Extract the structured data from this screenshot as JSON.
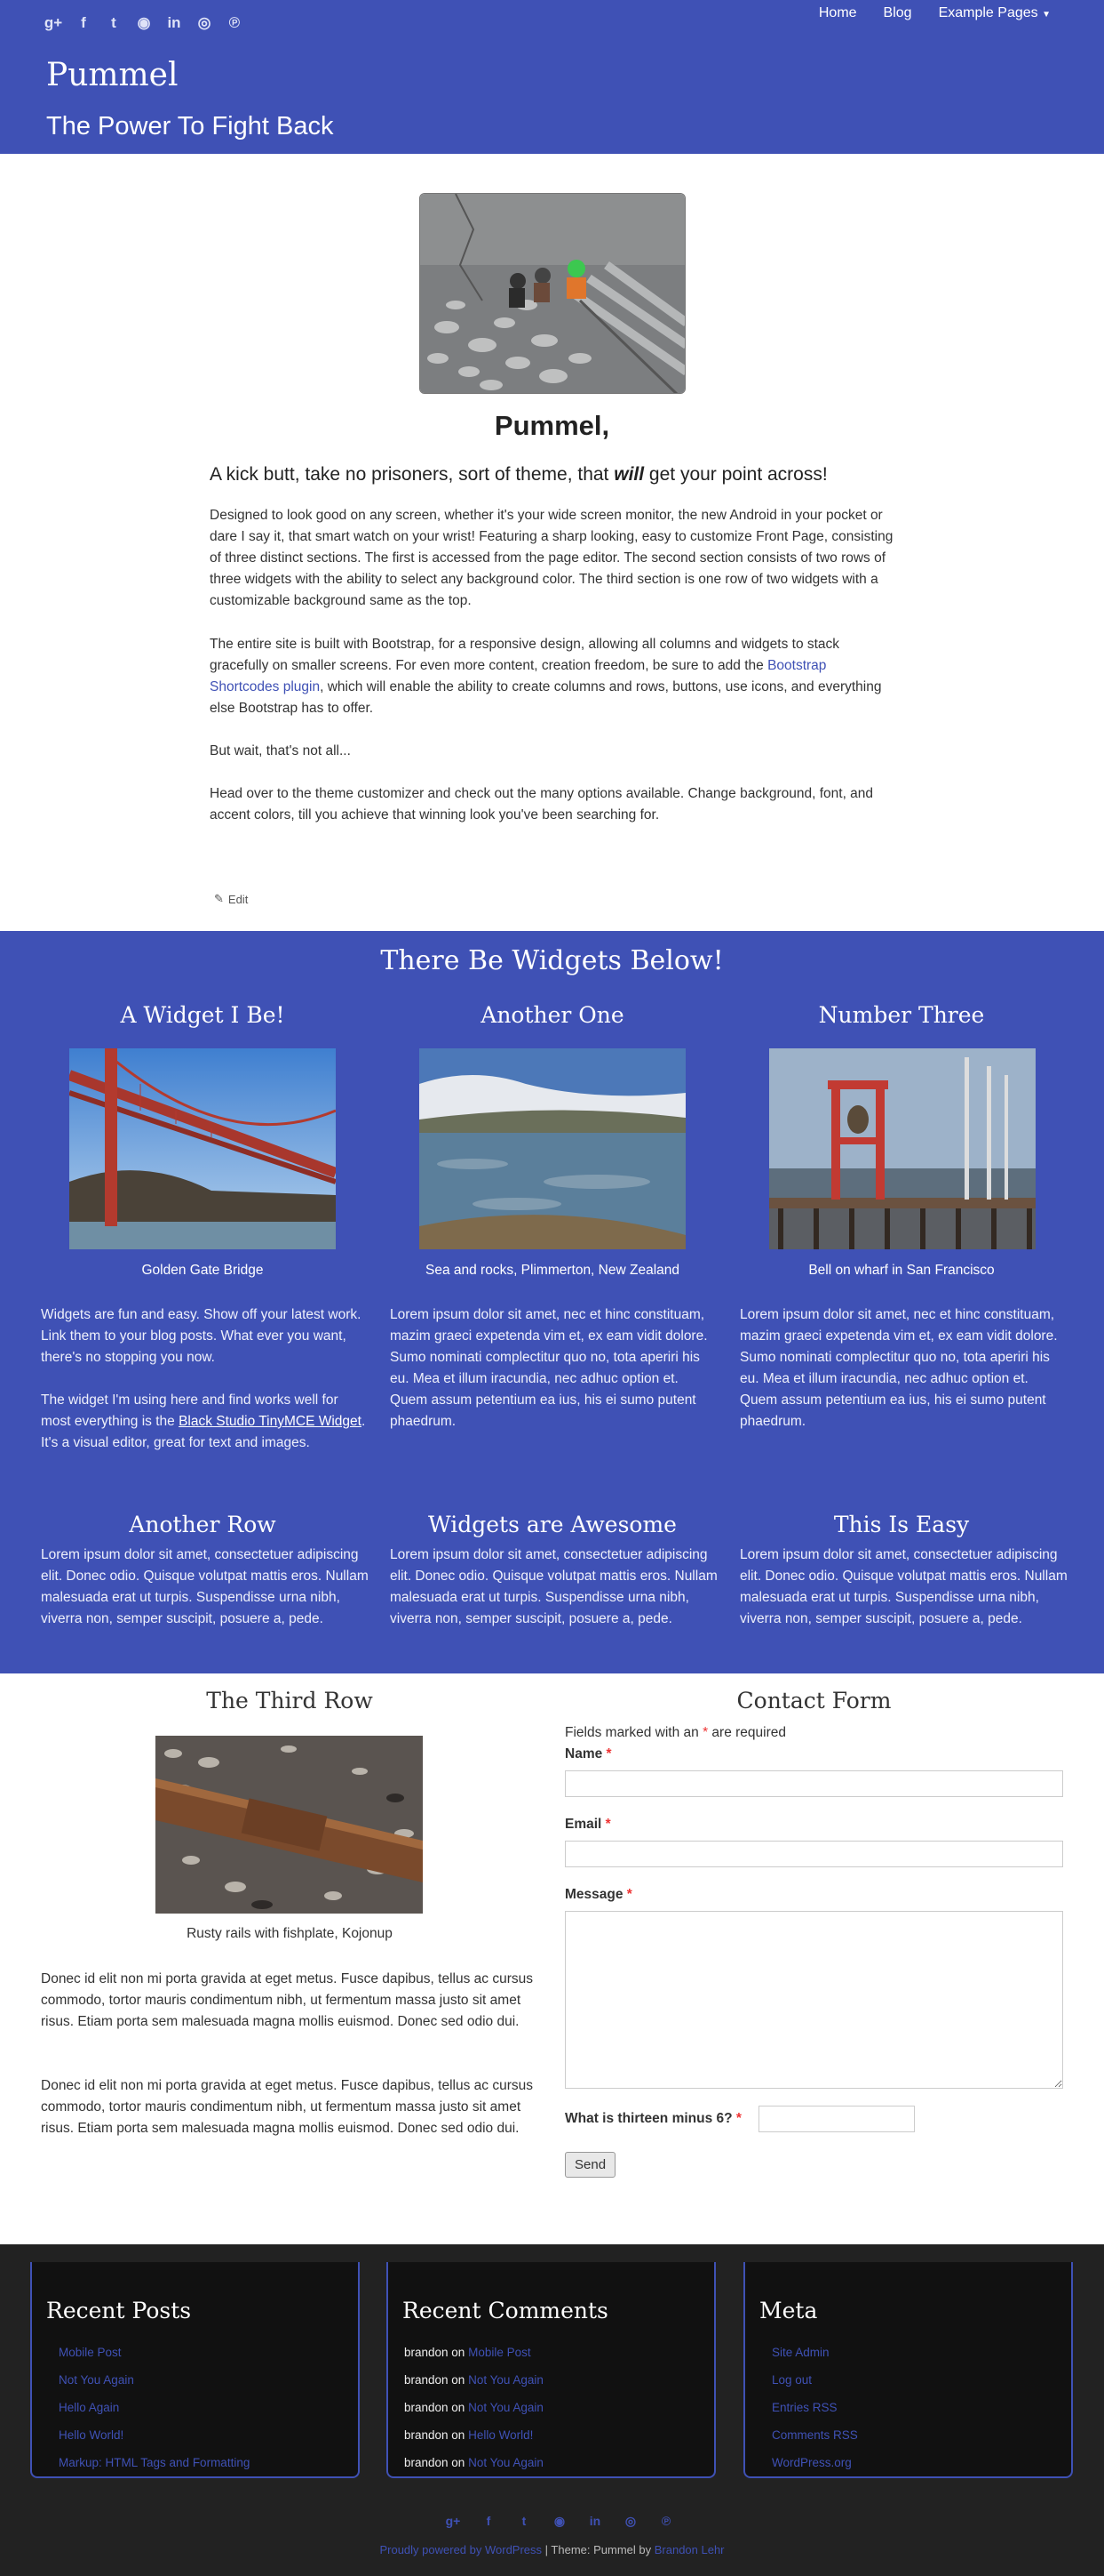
{
  "header": {
    "social_icons": [
      "google-plus-icon",
      "facebook-icon",
      "twitter-icon",
      "github-icon",
      "linkedin-icon",
      "instagram-icon",
      "pinterest-icon"
    ],
    "social_glyphs": [
      "g+",
      "f",
      "t",
      "◉",
      "in",
      "◎",
      "℗"
    ],
    "nav": [
      "Home",
      "Blog",
      "Example Pages"
    ],
    "site_title": "Pummel",
    "site_description": "The Power To Fight Back"
  },
  "main": {
    "heading": "Pummel,",
    "lead_before": "A kick butt, take no prisoners, sort of theme, that ",
    "lead_em": "will",
    "lead_after": " get your point across!",
    "p1": "Designed to look good on any screen, whether it's your wide screen monitor, the new Android in your pocket or dare I say it, that smart watch on your wrist! Featuring a sharp looking, easy to customize Front Page, consisting of three distinct sections. The first is accessed from the page editor. The second section consists of two rows of three widgets with the ability to select any background color. The third section is one row of two widgets with a customizable background  same as the top.",
    "p2_before": "The entire site is built with Bootstrap, for a responsive design, allowing all columns and widgets to stack gracefully on smaller screens. For even more content, creation freedom, be sure to add the ",
    "p2_link": "Bootstrap Shortcodes plugin",
    "p2_after": ", which will enable the ability to create columns and rows, buttons, use icons, and everything else Bootstrap has to offer.",
    "p3": "But wait, that's not all...",
    "p4": "Head over to the theme customizer and check out the many options available. Change background, font, and accent colors, till you achieve that winning look you've been searching for.",
    "edit_label": "Edit"
  },
  "widgets": {
    "section_title": "There Be Widgets Below!",
    "row1": [
      {
        "title": "A Widget I Be!",
        "caption": "Golden Gate Bridge",
        "text1": "Widgets are fun and easy. Show off your latest work. Link them to your blog posts. What ever you want, there's no stopping you now.",
        "text2_before": "The widget I'm using here and find works well for most everything is the ",
        "text2_link": "Black Studio TinyMCE Widget",
        "text2_after": ". It's a visual editor,  great for text and images."
      },
      {
        "title": "Another One",
        "caption": "Sea and rocks, Plimmerton, New Zealand",
        "text1": "Lorem ipsum dolor sit amet, nec et hinc constituam, mazim graeci expetenda vim et, ex eam vidit dolore. Sumo nominati complectitur quo no, tota aperiri his eu. Mea et illum iracundia, nec adhuc option et. Quem assum petentium ea ius, his ei sumo putent phaedrum."
      },
      {
        "title": "Number Three",
        "caption": "Bell on wharf in San Francisco",
        "text1": "Lorem ipsum dolor sit amet, nec et hinc constituam, mazim graeci expetenda vim et, ex eam vidit dolore. Sumo nominati complectitur quo no, tota aperiri his eu. Mea et illum iracundia, nec adhuc option et. Quem assum petentium ea ius, his ei sumo putent phaedrum."
      }
    ],
    "row2": [
      {
        "title": "Another Row",
        "text": "Lorem ipsum dolor sit amet, consectetuer adipiscing elit. Donec odio. Quisque volutpat mattis eros. Nullam malesuada erat ut turpis. Suspendisse urna nibh, viverra non, semper suscipit, posuere a, pede."
      },
      {
        "title": "Widgets are Awesome",
        "text": "Lorem ipsum dolor sit amet, consectetuer adipiscing elit. Donec odio. Quisque volutpat mattis eros. Nullam malesuada erat ut turpis. Suspendisse urna nibh, viverra non, semper suscipit, posuere a, pede."
      },
      {
        "title": "This Is Easy",
        "text": "Lorem ipsum dolor sit amet, consectetuer adipiscing elit. Donec odio. Quisque volutpat mattis eros. Nullam malesuada erat ut turpis. Suspendisse urna nibh, viverra non, semper suscipit, posuere a, pede."
      }
    ]
  },
  "third_row": {
    "left_title": "The Third Row",
    "caption": "Rusty rails with fishplate, Kojonup",
    "p1": "Donec id elit non mi porta gravida at eget metus. Fusce dapibus, tellus ac cursus commodo, tortor mauris condimentum nibh, ut fermentum massa justo sit amet risus. Etiam porta sem malesuada magna mollis euismod. Donec sed odio dui.",
    "p2": "Donec id elit non mi porta gravida at eget metus. Fusce dapibus, tellus ac cursus commodo, tortor mauris condimentum nibh, ut fermentum massa justo sit amet risus. Etiam porta sem malesuada magna mollis euismod. Donec sed odio dui.",
    "form_title": "Contact Form",
    "required_before": "Fields marked with an ",
    "required_star": "*",
    "required_after": " are required",
    "name_label": "Name",
    "email_label": "Email",
    "message_label": "Message",
    "captcha_label": "What is thirteen minus 6?",
    "send_label": "Send"
  },
  "footer": {
    "recent_posts_title": "Recent Posts",
    "recent_posts": [
      "Mobile Post",
      "Not You Again",
      "Hello Again",
      "Hello World!",
      "Markup: HTML Tags and Formatting"
    ],
    "recent_comments_title": "Recent Comments",
    "comment_author": "brandon",
    "comment_on": " on ",
    "recent_comments": [
      "Mobile Post",
      "Not You Again",
      "Not You Again",
      "Hello World!",
      "Not You Again"
    ],
    "meta_title": "Meta",
    "meta_links": [
      "Site Admin",
      "Log out",
      "Entries RSS",
      "Comments RSS",
      "WordPress.org"
    ],
    "credit_link1": "Proudly powered by WordPress",
    "credit_mid": " | Theme: Pummel by ",
    "credit_link2": "Brandon Lehr"
  },
  "colors": {
    "accent": "#3f51b5",
    "footer_bg": "#222222",
    "footer_box": "#111111"
  }
}
